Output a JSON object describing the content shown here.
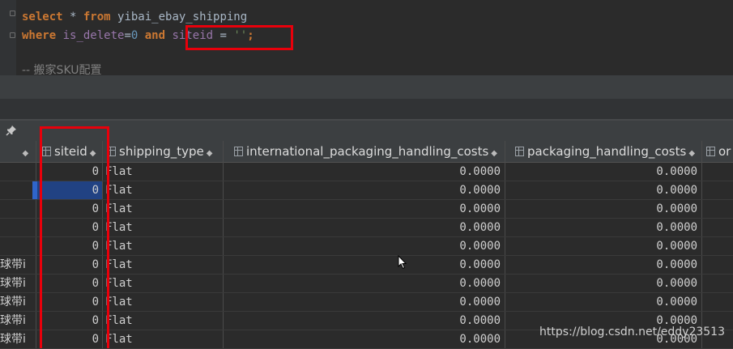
{
  "editor": {
    "line1": {
      "select": "select",
      "star": " * ",
      "from": "from",
      "table": " yibai_ebay_shipping"
    },
    "line2": {
      "where": "where",
      "col1": " is_delete",
      "eq1": "=",
      "num": "0",
      "and": " and ",
      "col2": "siteid",
      "eq2": " = ",
      "str": "''",
      "semi": ";"
    },
    "comment": "-- 搬家SKU配置"
  },
  "grid": {
    "columns": [
      {
        "name": "siteid"
      },
      {
        "name": "shipping_type"
      },
      {
        "name": "international_packaging_handling_costs"
      },
      {
        "name": "packaging_handling_costs"
      },
      {
        "name": "or"
      }
    ],
    "rows": [
      {
        "left": "",
        "siteid": "0",
        "shipping_type": "Flat",
        "intl": "0.0000",
        "pack": "0.0000"
      },
      {
        "left": "",
        "siteid": "0",
        "shipping_type": "Flat",
        "intl": "0.0000",
        "pack": "0.0000"
      },
      {
        "left": "",
        "siteid": "0",
        "shipping_type": "Flat",
        "intl": "0.0000",
        "pack": "0.0000"
      },
      {
        "left": "",
        "siteid": "0",
        "shipping_type": "Flat",
        "intl": "0.0000",
        "pack": "0.0000"
      },
      {
        "left": "",
        "siteid": "0",
        "shipping_type": "Flat",
        "intl": "0.0000",
        "pack": "0.0000"
      },
      {
        "left": "球带i",
        "siteid": "0",
        "shipping_type": "Flat",
        "intl": "0.0000",
        "pack": "0.0000"
      },
      {
        "left": "球带i",
        "siteid": "0",
        "shipping_type": "Flat",
        "intl": "0.0000",
        "pack": "0.0000"
      },
      {
        "left": "球带i",
        "siteid": "0",
        "shipping_type": "Flat",
        "intl": "0.0000",
        "pack": "0.0000"
      },
      {
        "left": "球带i",
        "siteid": "0",
        "shipping_type": "Flat",
        "intl": "0.0000",
        "pack": "0.0000"
      },
      {
        "left": "球带i",
        "siteid": "0",
        "shipping_type": "Flat",
        "intl": "0.0000",
        "pack": "0.0000"
      }
    ],
    "selected_row_index": 1
  },
  "watermark": "https://blog.csdn.net/eddy23513",
  "colors": {
    "highlight_box": "#e8000b",
    "keyword": "#cc7832",
    "selection": "#214283"
  }
}
